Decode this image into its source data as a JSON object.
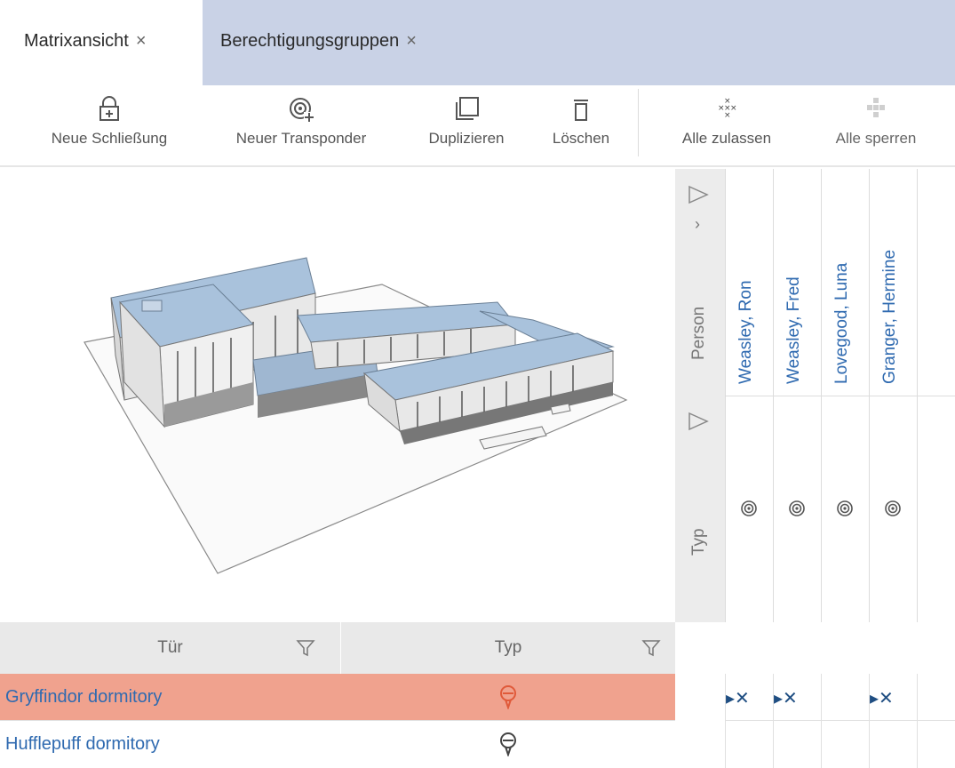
{
  "tabs": [
    {
      "label": "Matrixansicht",
      "close": "×"
    },
    {
      "label": "Berechtigungsgruppen",
      "close": "×"
    }
  ],
  "toolbar": {
    "new_lock": "Neue Schließung",
    "new_transponder": "Neuer Transponder",
    "duplicate": "Duplizieren",
    "delete": "Löschen",
    "allow_all": "Alle zulassen",
    "block_all": "Alle sperren"
  },
  "header": {
    "person_label": "Person",
    "type_label": "Typ",
    "persons": [
      "Weasley, Ron",
      "Weasley, Fred",
      "Lovegood, Luna",
      "Granger, Hermine"
    ]
  },
  "table": {
    "col_door": "Tür",
    "col_type": "Typ",
    "rows": [
      {
        "door": "Gryffindor dormitory",
        "marks": [
          "▸✕",
          "▸✕",
          "",
          "▸✕"
        ]
      },
      {
        "door": "Hufflepuff dormitory",
        "marks": [
          "",
          "",
          "",
          ""
        ]
      }
    ]
  },
  "colors": {
    "tabbar": "#c9d2e6",
    "link": "#2f6ab0",
    "selected_row": "#f0a28e",
    "selected_icon": "#e05a3a",
    "mark": "#1f4e82"
  }
}
